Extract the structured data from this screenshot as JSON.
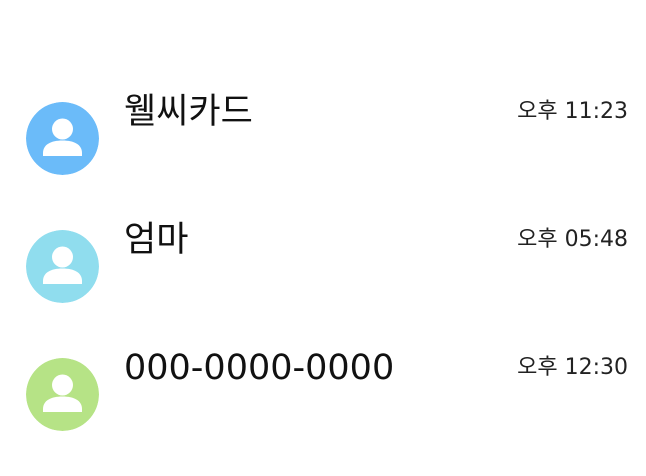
{
  "conversations": [
    {
      "name": "웰씨카드",
      "time": "오후 11:23",
      "avatar_color": "#6BBBF9",
      "avatar_icon": "person-icon"
    },
    {
      "name": "엄마",
      "time": "오후 05:48",
      "avatar_color": "#90DDEE",
      "avatar_icon": "person-icon"
    },
    {
      "name": "000-0000-0000",
      "time": "오후 12:30",
      "avatar_color": "#B6E386",
      "avatar_icon": "person-icon"
    }
  ]
}
